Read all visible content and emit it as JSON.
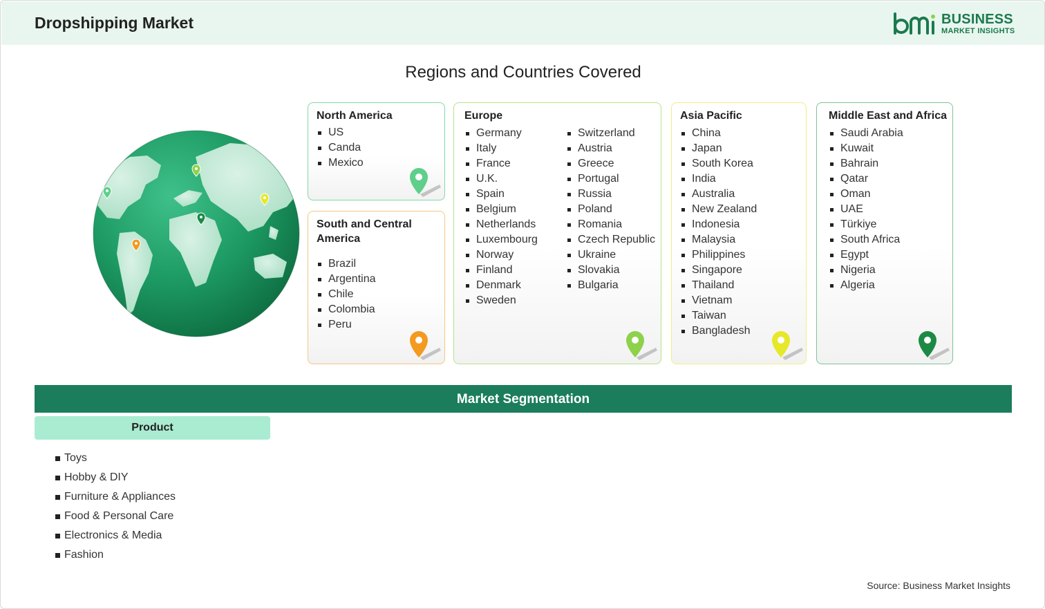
{
  "header": {
    "title": "Dropshipping Market",
    "logo_line1": "BUSINESS",
    "logo_line2": "MARKET INSIGHTS"
  },
  "regions_title": "Regions and Countries Covered",
  "regions": {
    "north_america": {
      "title": "North America",
      "countries": [
        "US",
        "Canda",
        "Mexico"
      ],
      "color": "#5fcf8a"
    },
    "south_central_america": {
      "title": "South and Central America",
      "countries": [
        "Brazil",
        "Argentina",
        "Chile",
        "Colombia",
        "Peru"
      ],
      "color": "#f39a1f"
    },
    "europe": {
      "title": "Europe",
      "countries_col1": [
        "Germany",
        "Italy",
        "France",
        "U.K.",
        "Spain",
        "Belgium",
        "Netherlands",
        "Luxembourg",
        "Norway",
        "Finland",
        "Denmark",
        "Sweden"
      ],
      "countries_col2": [
        "Switzerland",
        "Austria",
        "Greece",
        "Portugal",
        "Russia",
        "Poland",
        "Romania",
        "Czech Republic",
        "Ukraine",
        "Slovakia",
        "Bulgaria"
      ],
      "color": "#8ed14b"
    },
    "asia_pacific": {
      "title": "Asia Pacific",
      "countries": [
        "China",
        "Japan",
        "South Korea",
        "India",
        "Australia",
        "New Zealand",
        "Indonesia",
        "Malaysia",
        "Philippines",
        "Singapore",
        "Thailand",
        "Vietnam",
        "Taiwan",
        "Bangladesh"
      ],
      "color": "#e6e82a"
    },
    "middle_east_africa": {
      "title": "Middle East and Africa",
      "countries": [
        "Saudi Arabia",
        "Kuwait",
        "Bahrain",
        "Qatar",
        "Oman",
        "UAE",
        "Türkiye",
        "South Africa",
        "Egypt",
        "Nigeria",
        "Algeria"
      ],
      "color": "#1c8a45"
    }
  },
  "segmentation": {
    "title": "Market Segmentation",
    "product_tab": "Product",
    "products": [
      "Toys",
      "Hobby & DIY",
      "Furniture & Appliances",
      "Food & Personal Care",
      "Electronics & Media",
      "Fashion"
    ]
  },
  "source": "Source: Business Market Insights",
  "colors": {
    "brand": "#1b7d5c",
    "header_bg": "#e9f6ef",
    "tab_bg": "#a9ecd2"
  }
}
